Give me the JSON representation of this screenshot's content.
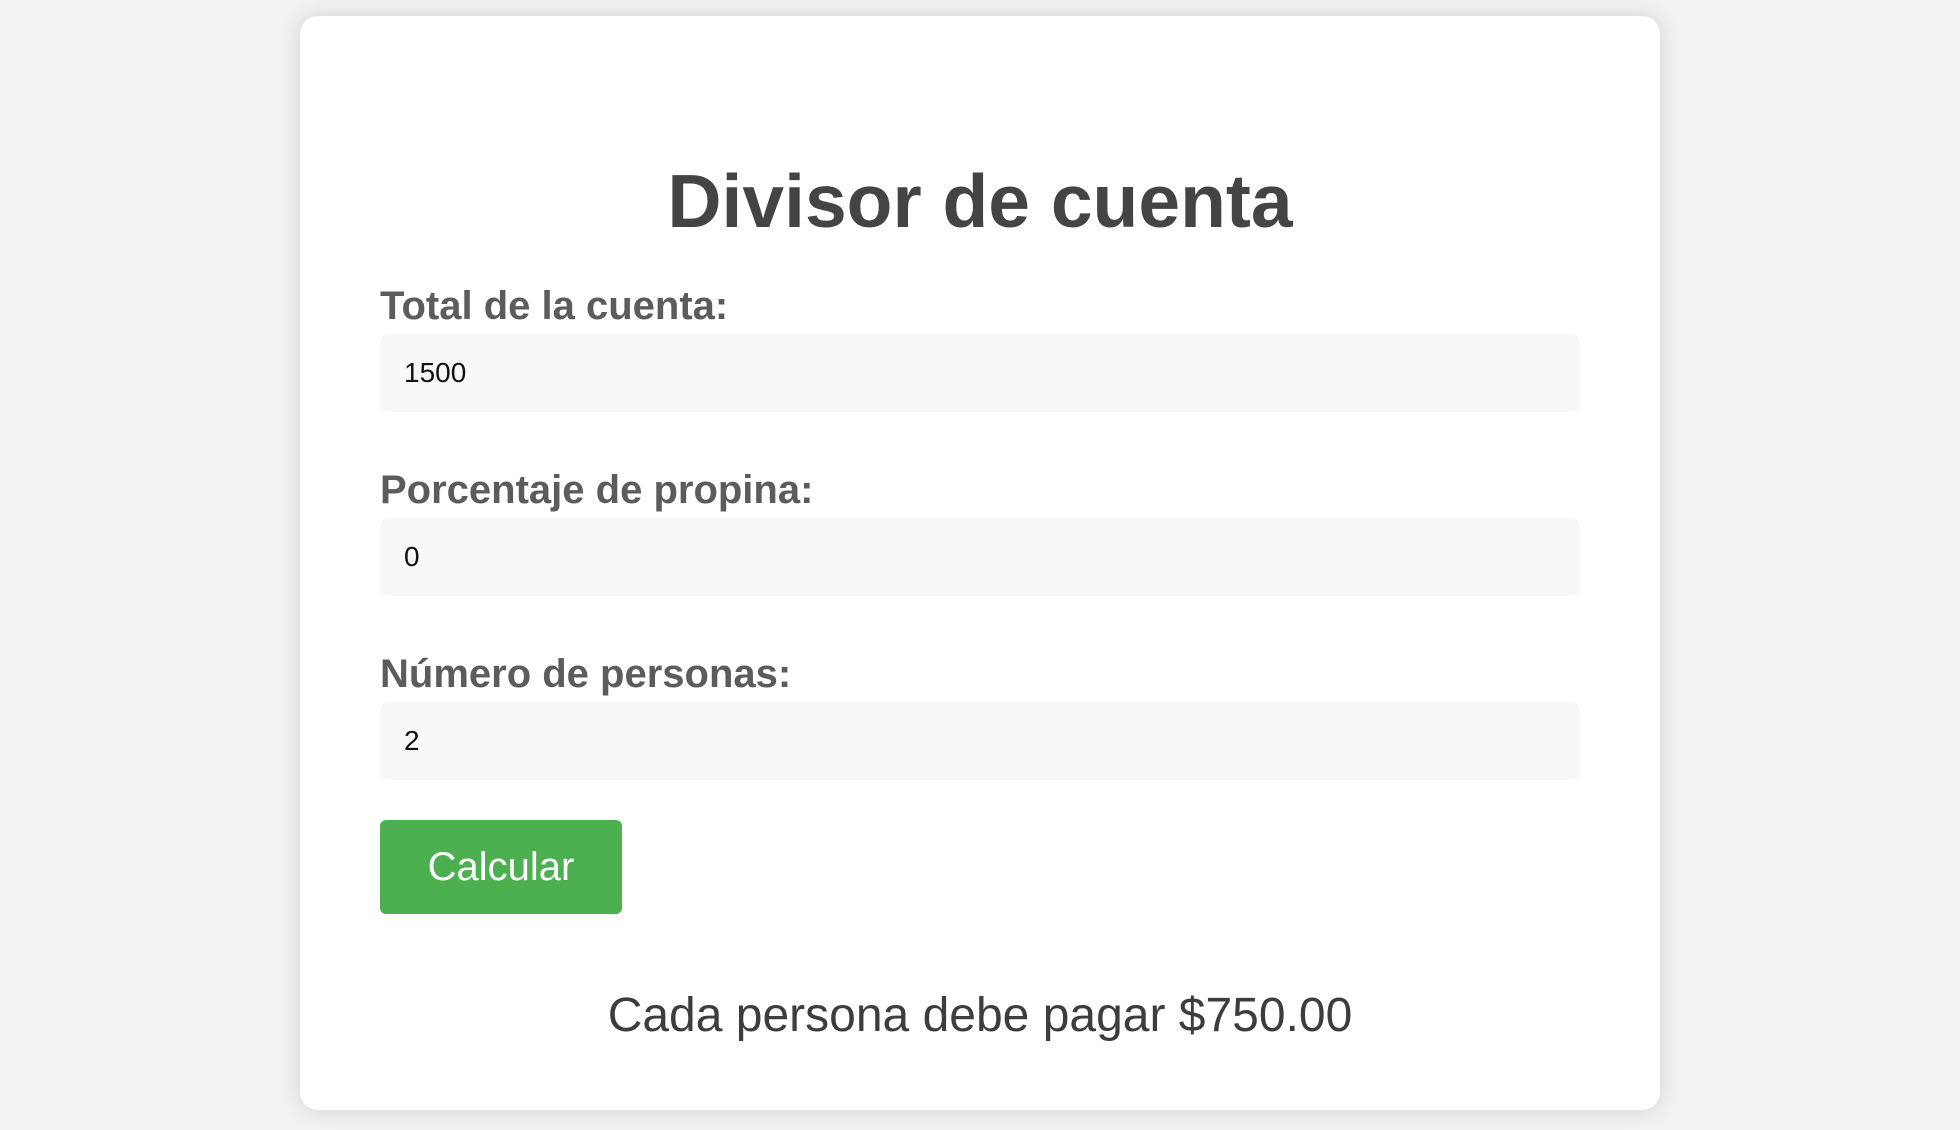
{
  "app": {
    "title": "Divisor de cuenta"
  },
  "form": {
    "total": {
      "label": "Total de la cuenta:",
      "value": "1500"
    },
    "tip": {
      "label": "Porcentaje de propina:",
      "value": "0"
    },
    "people": {
      "label": "Número de personas:",
      "value": "2"
    },
    "calculate_label": "Calcular"
  },
  "result": {
    "text": "Cada persona debe pagar $750.00"
  },
  "colors": {
    "page_background": "#f2f2f2",
    "card_background": "#ffffff",
    "button_green": "#4caf50",
    "title_text": "#444444",
    "label_text": "#5c5c5c"
  }
}
